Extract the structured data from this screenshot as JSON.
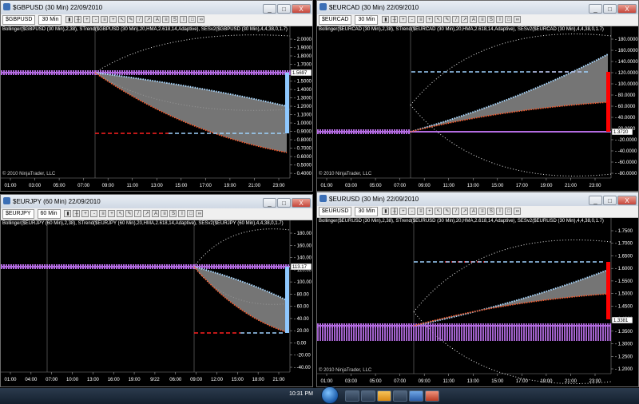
{
  "taskbar": {
    "clock": "10:31 PM",
    "apps": [
      "explorer-app",
      "media-app",
      "outlook-app",
      "tray-app",
      "ninjatrader-app",
      "browser-app"
    ]
  },
  "colors": {
    "upper_band": "#a8d8ff",
    "lower_band": "#ff5a2a",
    "band_fill": "#8a8a8a",
    "strip": "#b36be0",
    "dash_red": "#ff2020",
    "dash_blue": "#9fd3ff",
    "envelope": "#e8e8e8",
    "price_box": "#ffffff",
    "red_bar": "#ff0000",
    "blue_bar": "#8ec8ff"
  },
  "windows": [
    {
      "id": "gbpusd",
      "title": "$GBPUSD (30 Min)  22/09/2010",
      "instrument": "$GBPUSD",
      "period": "30 Min",
      "indicators": "Bollinger($GBPUSD (30 Min),2,38), STrend($GBPUSD (30 Min),20,HMA,2.618,14,Adaptive), SESv2($GBPUSD (30 Min),4,4,38,0,1.7)",
      "copyright": "© 2010 NinjaTrader, LLC",
      "y_labels": [
        "2.0000",
        "1.9000",
        "1.8000",
        "1.7000",
        "1.6000",
        "1.5000",
        "1.4000",
        "1.3000",
        "1.2000",
        "1.1000",
        "1.0000",
        "0.9000",
        "0.8000",
        "0.7000",
        "0.6000",
        "0.5000",
        "0.4000"
      ],
      "x_labels": [
        "01:00",
        "03:00",
        "05:00",
        "07:00",
        "09:00",
        "11:00",
        "13:00",
        "15:00",
        "17:00",
        "19:00",
        "21:00",
        "23:00"
      ],
      "price_label": "1.5697",
      "toolbar_icons": [
        "bar-icon",
        "chart-type-icon",
        "zoom-in-icon",
        "zoom-out-icon",
        "properties-icon",
        "crosshair-icon",
        "pointer-icon",
        "draw-icon",
        "line-icon",
        "ray-icon",
        "text-icon",
        "fib-icon",
        "strategy-icon",
        "indicator-icon",
        "data-box-icon",
        "link-icon"
      ],
      "window_buttons": {
        "minimize": "_",
        "maximize": "□",
        "close": "X"
      }
    },
    {
      "id": "eurcad",
      "title": "$EURCAD (30 Min)  22/09/2010",
      "instrument": "$EURCAD",
      "period": "30 Min",
      "indicators": "Bollinger($EURCAD (30 Min),2,38), STrend($EURCAD (30 Min),20,HMA,2.618,14,Adaptive), SESv2($EURCAD (30 Min),4,4,38,0,1.7)",
      "copyright": "© 2010 NinjaTrader, LLC",
      "y_labels": [
        "180.0000",
        "160.0000",
        "140.0000",
        "120.0000",
        "100.0000",
        "80.0000",
        "60.0000",
        "40.0000",
        "20.0000",
        "-20.0000",
        "-40.0000",
        "-60.0000",
        "-80.0000"
      ],
      "x_labels": [
        "01:00",
        "03:00",
        "05:00",
        "07:00",
        "09:00",
        "11:00",
        "13:00",
        "15:00",
        "17:00",
        "19:00",
        "21:00",
        "23:00"
      ],
      "price_label": "1.3720",
      "window_buttons": {
        "minimize": "_",
        "maximize": "□",
        "close": "X"
      }
    },
    {
      "id": "eurjpy",
      "title": "$EURJPY (60 Min)  22/09/2010",
      "instrument": "$EURJPY",
      "period": "60 Min",
      "indicators": "Bollinger($EURJPY (60 Min),2,38), STrend($EURJPY (60 Min),20,HMA,2.618,14,Adaptive), SESv2($EURJPY (60 Min),4,4,38,0,1.7)",
      "copyright": "© 2010 NinjaTrader, LLC",
      "y_labels": [
        "180.00",
        "160.00",
        "140.00",
        "120.00",
        "100.00",
        "80.00",
        "60.00",
        "40.00",
        "20.00",
        "0.00",
        "-20.00",
        "-40.00"
      ],
      "x_labels": [
        "01:00",
        "04:00",
        "07:00",
        "10:00",
        "13:00",
        "16:00",
        "19:00",
        "9/22",
        "06:00",
        "09:00",
        "12:00",
        "15:00",
        "18:00",
        "21:00"
      ],
      "price_label": "113.17",
      "window_buttons": {
        "minimize": "_",
        "maximize": "□",
        "close": "X"
      }
    },
    {
      "id": "eurusd",
      "title": "$EURUSD (30 Min)  22/09/2010",
      "instrument": "$EURUSD",
      "period": "30 Min",
      "indicators": "Bollinger($EURUSD (30 Min),2,38), STrend($EURUSD (30 Min),20,HMA,2.618,14,Adaptive), SESv2($EURUSD (30 Min),4,4,38,0,1.7)",
      "copyright": "© 2010 NinjaTrader, LLC",
      "y_labels": [
        "1.7500",
        "1.7000",
        "1.6500",
        "1.6000",
        "1.5500",
        "1.5000",
        "1.4500",
        "1.4000",
        "1.3500",
        "1.3000",
        "1.2500",
        "1.2000"
      ],
      "x_labels": [
        "01:00",
        "03:00",
        "05:00",
        "07:00",
        "09:00",
        "11:00",
        "13:00",
        "15:00",
        "17:00",
        "19:00",
        "21:00",
        "23:00"
      ],
      "price_label": "1.3381",
      "window_buttons": {
        "minimize": "_",
        "maximize": "□",
        "close": "X"
      }
    }
  ]
}
